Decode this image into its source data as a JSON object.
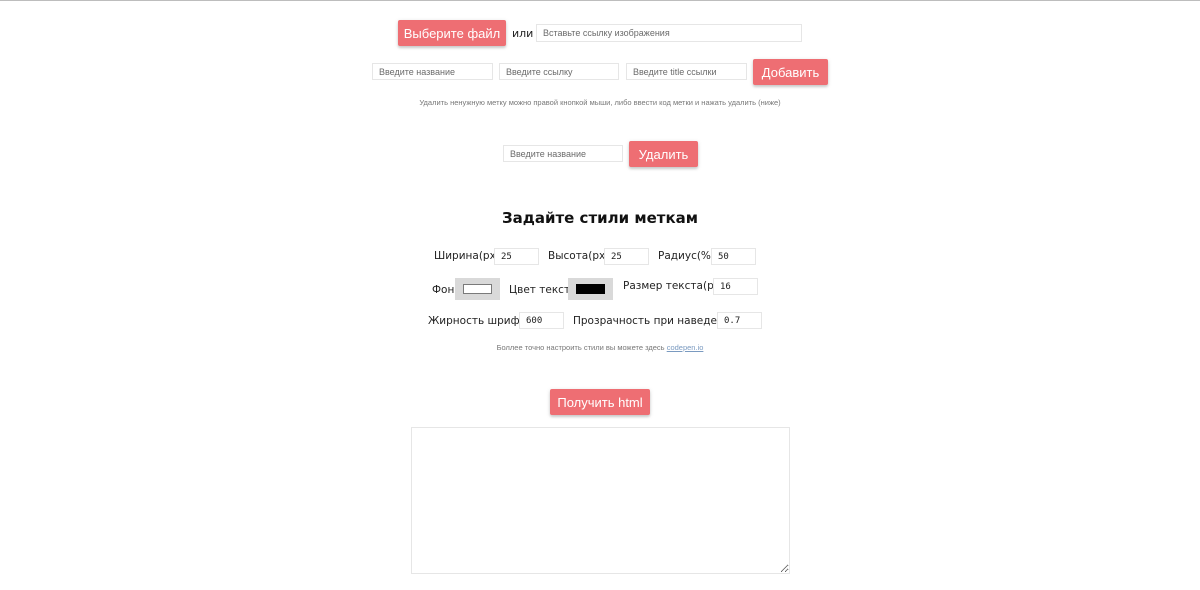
{
  "upload": {
    "choose_file_label": "Выберите файл",
    "or_label": "или",
    "image_url_placeholder": "Вставьте ссылку изображения"
  },
  "add_marker": {
    "name_placeholder": "Введите название",
    "link_placeholder": "Введите ссылку",
    "title_placeholder": "Введите title ссылки",
    "add_label": "Добавить",
    "hint": "Удалить ненужную метку можно правой кнопкой мыши, либо ввести код метки и нажать удалить (ниже)"
  },
  "delete_marker": {
    "name_placeholder": "Введите название",
    "delete_label": "Удалить"
  },
  "styles": {
    "heading": "Задайте стили меткам",
    "width_label": "Ширина(px)",
    "width_value": "25",
    "height_label": "Высота(px)",
    "height_value": "25",
    "radius_label": "Радиус(%)",
    "radius_value": "50",
    "bg_label": "Фон",
    "bg_color": "#ffffff",
    "text_color_label": "Цвет текста",
    "text_color": "#000000",
    "font_size_label": "Размер текста(px)",
    "font_size_value": "16",
    "font_weight_label": "Жирность шрифта",
    "font_weight_value": "600",
    "hover_opacity_label": "Прозрачность при наведении",
    "hover_opacity_value": "0.7",
    "note_prefix": "Боллее точно настроить стили вы можете здесь",
    "note_link": "codepen.io"
  },
  "output": {
    "get_html_label": "Получить html",
    "code": ""
  },
  "colors": {
    "accent": "#ee6e73",
    "input_border": "#e6e6e6",
    "swatch_bg": "#d9d9d9",
    "link": "#7a9ac0"
  }
}
